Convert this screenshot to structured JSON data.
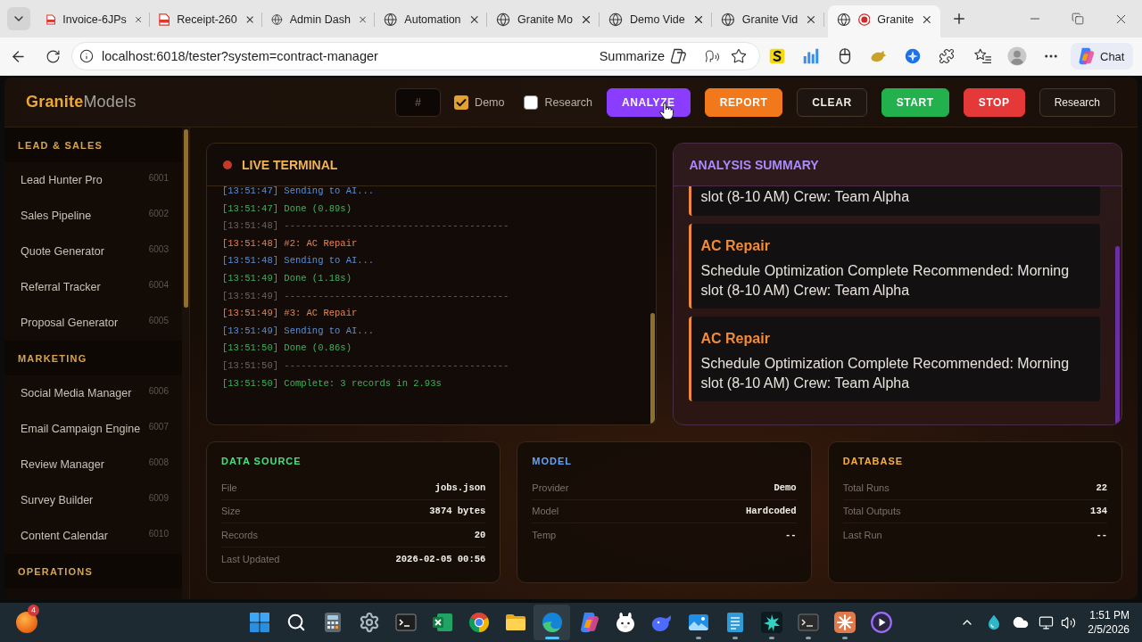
{
  "browser": {
    "tabs": [
      {
        "title": "Invoice-6JPs",
        "kind": "pdf",
        "selected": false,
        "recording": false
      },
      {
        "title": "Receipt-260",
        "kind": "pdf",
        "selected": false,
        "recording": false
      },
      {
        "title": "Admin Dash",
        "kind": "web",
        "selected": false,
        "recording": false
      },
      {
        "title": "Automation",
        "kind": "web",
        "selected": false,
        "recording": false
      },
      {
        "title": "Granite Mo",
        "kind": "web",
        "selected": false,
        "recording": false
      },
      {
        "title": "Demo Vide",
        "kind": "web",
        "selected": false,
        "recording": false
      },
      {
        "title": "Granite Vid",
        "kind": "web",
        "selected": false,
        "recording": false
      },
      {
        "title": "Granite",
        "kind": "web",
        "selected": true,
        "recording": true
      }
    ],
    "address": "localhost:6018/tester?system=contract-manager",
    "summarize": "Summarize",
    "chat": "Chat"
  },
  "app": {
    "header": {
      "logo": "**Granite**Models",
      "number_field": {
        "placeholder": "#"
      },
      "toggles": [
        {
          "label": "Demo",
          "checked": true
        },
        {
          "label": "Research",
          "checked": false
        }
      ],
      "buttons": [
        {
          "label": "ANALYZE",
          "kind": "analyze",
          "hovered": true
        },
        {
          "label": "REPORT",
          "kind": "report",
          "hovered": false
        },
        {
          "label": "CLEAR",
          "kind": "clear",
          "hovered": false
        },
        {
          "label": "START",
          "kind": "start",
          "hovered": false
        },
        {
          "label": "STOP",
          "kind": "stop",
          "hovered": false
        },
        {
          "label": "Research",
          "kind": "secondary",
          "hovered": false
        }
      ]
    },
    "sidebar": {
      "sections": [
        {
          "title": "LEAD & SALES",
          "items": [
            {
              "name": "Lead Hunter Pro",
              "port": "6001"
            },
            {
              "name": "Sales Pipeline",
              "port": "6002"
            },
            {
              "name": "Quote Generator",
              "port": "6003"
            },
            {
              "name": "Referral Tracker",
              "port": "6004"
            },
            {
              "name": "Proposal Generator",
              "port": "6005"
            }
          ]
        },
        {
          "title": "MARKETING",
          "items": [
            {
              "name": "Social Media Manager",
              "port": "6006"
            },
            {
              "name": "Email Campaign Engine",
              "port": "6007"
            },
            {
              "name": "Review Manager",
              "port": "6008"
            },
            {
              "name": "Survey Builder",
              "port": "6009"
            },
            {
              "name": "Content Calendar",
              "port": "6010"
            }
          ]
        },
        {
          "title": "OPERATIONS"
        }
      ]
    },
    "terminal": {
      "title": "LIVE TERMINAL",
      "live": true,
      "lines": [
        {
          "time": "[13:51:47]",
          "message": "Sending to AI...",
          "kind": "info"
        },
        {
          "time": "[13:51:47]",
          "message": "Done (0.89s)",
          "kind": "success"
        },
        {
          "time": "[13:51:48]",
          "message": "----------------------------------------",
          "kind": "divider"
        },
        {
          "time": "[13:51:48]",
          "message": "#2: AC Repair",
          "kind": "record"
        },
        {
          "time": "[13:51:48]",
          "message": "Sending to AI...",
          "kind": "info"
        },
        {
          "time": "[13:51:49]",
          "message": "Done (1.18s)",
          "kind": "success"
        },
        {
          "time": "[13:51:49]",
          "message": "----------------------------------------",
          "kind": "divider"
        },
        {
          "time": "[13:51:49]",
          "message": "#3: AC Repair",
          "kind": "record"
        },
        {
          "time": "[13:51:49]",
          "message": "Sending to AI...",
          "kind": "info"
        },
        {
          "time": "[13:51:50]",
          "message": "Done (0.86s)",
          "kind": "success"
        },
        {
          "time": "[13:51:50]",
          "message": "----------------------------------------",
          "kind": "divider"
        },
        {
          "time": "[13:51:50]",
          "message": "Complete: 3 records in 2.93s",
          "kind": "success"
        }
      ]
    },
    "summary": {
      "title": "ANALYSIS SUMMARY",
      "entries": [
        {
          "text": "slot (8-10 AM) Crew: Team Alpha"
        },
        {
          "title": "AC Repair",
          "text": "Schedule Optimization Complete Recommended: Morning slot (8-10 AM) Crew: Team Alpha"
        },
        {
          "title": "AC Repair",
          "text": "Schedule Optimization Complete Recommended: Morning slot (8-10 AM) Crew: Team Alpha"
        }
      ]
    },
    "info_cards": [
      {
        "title": "DATA SOURCE",
        "color": "#4ade80",
        "rows": [
          {
            "label": "File",
            "value": "jobs.json"
          },
          {
            "label": "Size",
            "value": "3874 bytes"
          },
          {
            "label": "Records",
            "value": "20"
          },
          {
            "label": "Last Updated",
            "value": "2026-02-05 00:56"
          }
        ]
      },
      {
        "title": "MODEL",
        "color": "#60a5fa",
        "rows": [
          {
            "label": "Provider",
            "value": "Demo"
          },
          {
            "label": "Model",
            "value": "Hardcoded"
          },
          {
            "label": "Temp",
            "value": "--"
          }
        ]
      },
      {
        "title": "DATABASE",
        "color": "#f5b041",
        "rows": [
          {
            "label": "Total Runs",
            "value": "22"
          },
          {
            "label": "Total Outputs",
            "value": "134"
          },
          {
            "label": "Last Run",
            "value": "--"
          }
        ]
      }
    ]
  },
  "taskbar": {
    "badge": "4",
    "apps": [
      {
        "kind": "start",
        "running": false,
        "active": false
      },
      {
        "kind": "search",
        "running": false,
        "active": false
      },
      {
        "kind": "calculator",
        "running": false,
        "active": false
      },
      {
        "kind": "settings",
        "running": false,
        "active": false
      },
      {
        "kind": "console",
        "running": false,
        "active": false
      },
      {
        "kind": "spreadsheet",
        "running": false,
        "active": false
      },
      {
        "kind": "chrome",
        "running": false,
        "active": false
      },
      {
        "kind": "folder",
        "running": false,
        "active": false
      },
      {
        "kind": "edge",
        "running": true,
        "active": true
      },
      {
        "kind": "copilot",
        "running": false,
        "active": false
      },
      {
        "kind": "animal",
        "running": false,
        "active": false
      },
      {
        "kind": "whale",
        "running": false,
        "active": false
      },
      {
        "kind": "photos",
        "running": true,
        "active": false
      },
      {
        "kind": "notepad",
        "running": true,
        "active": false
      },
      {
        "kind": "spiky",
        "running": true,
        "active": false
      },
      {
        "kind": "terminal",
        "running": true,
        "active": false
      },
      {
        "kind": "starburst",
        "running": true,
        "active": false
      },
      {
        "kind": "media",
        "running": false,
        "active": false
      }
    ],
    "time": "1:51 PM",
    "date": "2/5/2026"
  }
}
